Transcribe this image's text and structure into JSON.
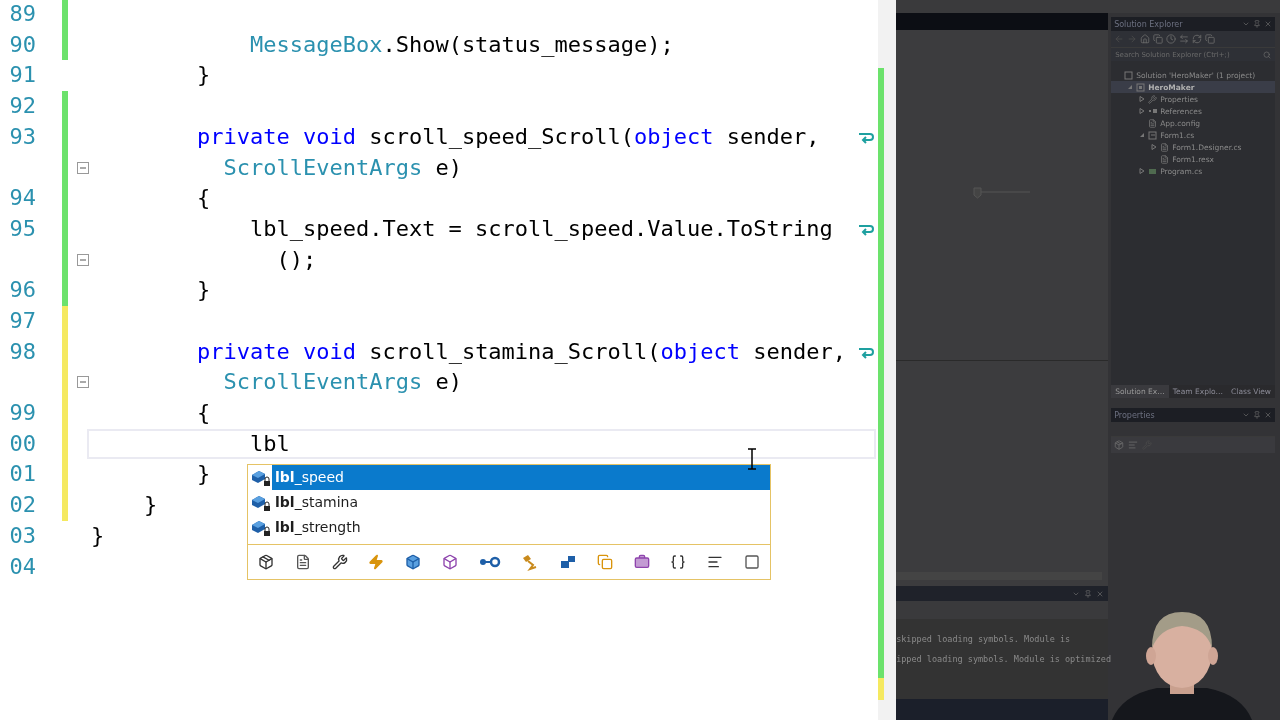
{
  "editor": {
    "lines": [
      {
        "number": "89",
        "modified": true,
        "saved": true
      },
      {
        "number": "90",
        "modified": true,
        "saved": true,
        "tokens": [
          {
            "kind": "type",
            "text": "            MessageBox"
          },
          {
            "kind": "plain",
            "text": ".Show(status_message);"
          }
        ]
      },
      {
        "number": "91",
        "modified": false,
        "tokens": [
          {
            "kind": "plain",
            "text": "        }"
          }
        ]
      },
      {
        "number": "92",
        "modified": true,
        "saved": true
      },
      {
        "number": "93",
        "modified": true,
        "saved": true,
        "tokens": [
          {
            "kind": "keyword",
            "text": "        private"
          },
          {
            "kind": "keyword",
            "text": " void"
          },
          {
            "kind": "plain",
            "text": " scroll_speed_Scroll("
          },
          {
            "kind": "keyword",
            "text": "object"
          },
          {
            "kind": "plain",
            "text": " sender,"
          }
        ],
        "wrap": [
          {
            "kind": "type",
            "text": "          ScrollEventArgs"
          },
          {
            "kind": "plain",
            "text": " e)"
          }
        ]
      },
      {
        "number": "94",
        "modified": true,
        "saved": true,
        "tokens": [
          {
            "kind": "plain",
            "text": "        {"
          }
        ]
      },
      {
        "number": "95",
        "modified": true,
        "saved": true,
        "tokens": [
          {
            "kind": "plain",
            "text": "            lbl_speed.Text = scroll_speed.Value.ToString"
          }
        ],
        "wrap": [
          {
            "kind": "plain",
            "text": "              ();"
          }
        ]
      },
      {
        "number": "96",
        "modified": true,
        "saved": true,
        "tokens": [
          {
            "kind": "plain",
            "text": "        }"
          }
        ]
      },
      {
        "number": "97",
        "modified": true,
        "saved": false
      },
      {
        "number": "98",
        "modified": true,
        "saved": false,
        "tokens": [
          {
            "kind": "keyword",
            "text": "        private"
          },
          {
            "kind": "keyword",
            "text": " void"
          },
          {
            "kind": "plain",
            "text": " scroll_stamina_Scroll("
          },
          {
            "kind": "keyword",
            "text": "object"
          },
          {
            "kind": "plain",
            "text": " sender,"
          }
        ],
        "wrap": [
          {
            "kind": "type",
            "text": "          ScrollEventArgs"
          },
          {
            "kind": "plain",
            "text": " e)"
          }
        ]
      },
      {
        "number": "99",
        "modified": true,
        "saved": false,
        "tokens": [
          {
            "kind": "plain",
            "text": "        {"
          }
        ]
      },
      {
        "number": "00",
        "modified": true,
        "saved": false,
        "current": true,
        "tokens": [
          {
            "kind": "plain",
            "text": "            lbl"
          }
        ]
      },
      {
        "number": "01",
        "modified": true,
        "saved": false,
        "tokens": [
          {
            "kind": "plain",
            "text": "        }"
          }
        ]
      },
      {
        "number": "02",
        "modified": true,
        "saved": false,
        "tokens": [
          {
            "kind": "plain",
            "text": "    }"
          }
        ]
      },
      {
        "number": "03",
        "modified": false,
        "tokens": [
          {
            "kind": "plain",
            "text": "}"
          }
        ]
      },
      {
        "number": "04",
        "modified": false
      }
    ]
  },
  "completion": {
    "items": [
      {
        "label": "**lbl**_speed",
        "selected": true
      },
      {
        "label": "**lbl**_stamina",
        "selected": false
      },
      {
        "label": "**lbl**_strength",
        "selected": false
      }
    ]
  },
  "solution_explorer": {
    "title": "Solution Explorer",
    "search_placeholder": "Search Solution Explorer (Ctrl+;)",
    "tree": [
      {
        "label": "Solution 'HeroMaker' (1 project)",
        "kind": "solution",
        "children": [
          {
            "label": "HeroMaker",
            "kind": "project",
            "expanded": true,
            "selected": true,
            "children": [
              {
                "label": "Properties",
                "kind": "properties",
                "expanded": false,
                "selected": false
              },
              {
                "label": "References",
                "kind": "references",
                "expanded": false,
                "selected": false
              },
              {
                "label": "App.config",
                "kind": "config",
                "selected": false
              },
              {
                "label": "Form1.cs",
                "kind": "form",
                "expanded": true,
                "selected": false,
                "children": [
                  {
                    "label": "Form1.Designer.cs",
                    "kind": "file",
                    "expanded": false,
                    "selected": false
                  },
                  {
                    "label": "Form1.resx",
                    "kind": "file",
                    "selected": false
                  }
                ]
              },
              {
                "label": "Program.cs",
                "kind": "csharp",
                "expanded": false,
                "selected": false
              }
            ]
          }
        ]
      }
    ]
  },
  "panel_tabs": [
    {
      "label": "Solution Ex…",
      "selected": true
    },
    {
      "label": "Team Explo…",
      "selected": false
    },
    {
      "label": "Class View",
      "selected": false
    }
  ],
  "properties": {
    "title": "Properties"
  },
  "output": {
    "lines": [
      "skipped loading symbols. Module is",
      "ipped loading symbols. Module is optimized"
    ]
  }
}
